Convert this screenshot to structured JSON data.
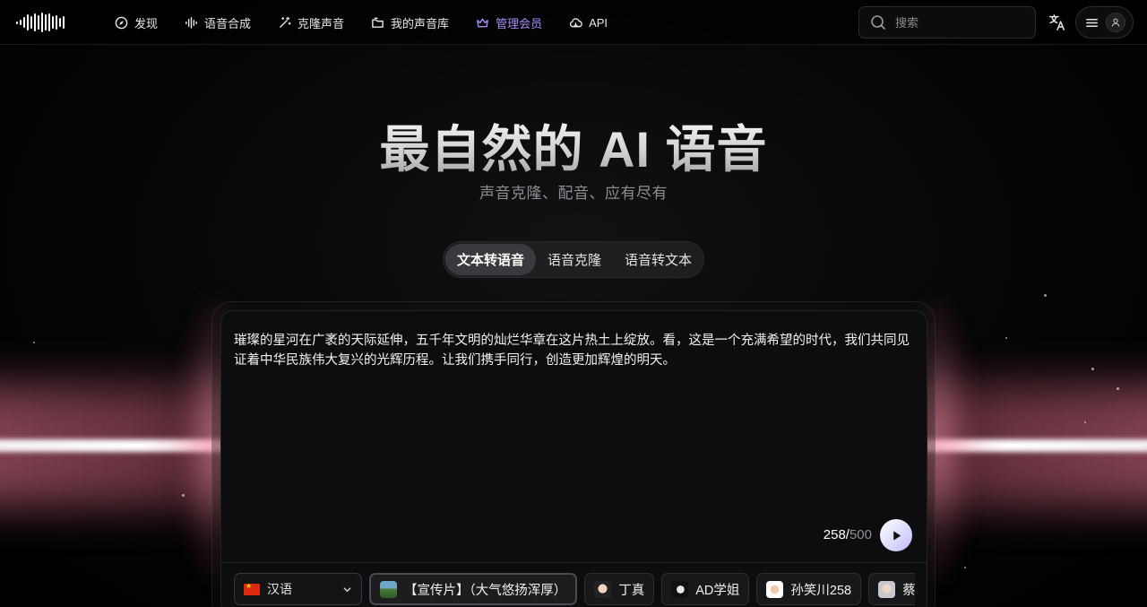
{
  "nav": {
    "items": [
      {
        "label": "发现",
        "icon": "compass-icon"
      },
      {
        "label": "语音合成",
        "icon": "waveform-icon"
      },
      {
        "label": "克隆声音",
        "icon": "magic-wand-icon"
      },
      {
        "label": "我的声音库",
        "icon": "folder-icon"
      },
      {
        "label": "管理会员",
        "icon": "crown-icon"
      },
      {
        "label": "API",
        "icon": "cloud-icon"
      }
    ],
    "search_placeholder": "搜索",
    "vip_color": "#a78bfa"
  },
  "hero": {
    "title": "最自然的 AI 语音",
    "subtitle": "声音克隆、配音、应有尽有"
  },
  "tabs": [
    {
      "label": "文本转语音",
      "active": true
    },
    {
      "label": "语音克隆",
      "active": false
    },
    {
      "label": "语音转文本",
      "active": false
    }
  ],
  "editor": {
    "text": "璀璨的星河在广袤的天际延伸，五千年文明的灿烂华章在这片热土上绽放。看，这是一个充满希望的时代，我们共同见证着中华民族伟大复兴的光辉历程。让我们携手同行，创造更加辉煌的明天。",
    "char_count": "258",
    "char_separator": "/",
    "char_max": "500"
  },
  "voices": {
    "language": "汉语",
    "items": [
      {
        "label": "【宣传片】（大气悠扬浑厚）",
        "selected": true
      },
      {
        "label": "丁真",
        "selected": false
      },
      {
        "label": "AD学姐",
        "selected": false
      },
      {
        "label": "孙笑川258",
        "selected": false
      },
      {
        "label": "蔡",
        "selected": false
      }
    ]
  }
}
